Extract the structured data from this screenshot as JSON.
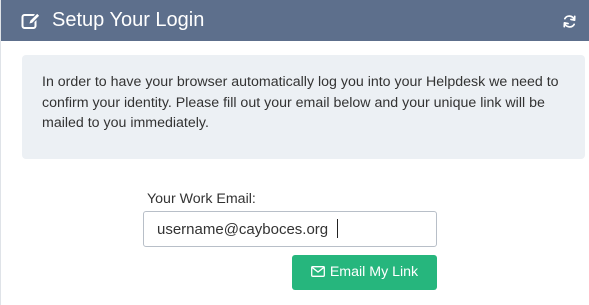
{
  "header": {
    "title": "Setup Your Login",
    "title_icon": "edit-icon",
    "refresh_icon": "refresh-icon",
    "background_color": "#5d6f8c"
  },
  "info": {
    "message": "In order to have your browser automatically log you into your Helpdesk we need to confirm your identity. Please fill out your email below and your unique link will be mailed to you immediately.",
    "background_color": "#ecf0f4"
  },
  "form": {
    "email_label": "Your Work Email:",
    "email_value": "username@cayboces.org",
    "submit_label": "Email My Link",
    "submit_icon": "envelope-icon",
    "submit_color": "#26b67d"
  }
}
